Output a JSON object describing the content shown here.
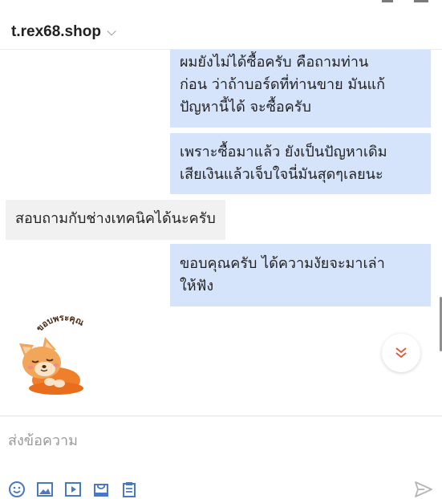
{
  "header": {
    "shop_name": "t.rex68.shop"
  },
  "messages": [
    {
      "side": "me",
      "text": "ผมยังไม่ได้ซื้อครับ คือถามท่าน\nก่อน ว่าถ้าบอร์ดที่ท่านขาย มันแก้\nปัญหานี้ได้ จะซื้อครับ"
    },
    {
      "side": "me",
      "text": "เพราะซื้อมาแล้ว ยังเป็นปัญหาเดิม\nเสียเงินแล้วเจ็บใจนี่มันสุดๆเลยนะ"
    },
    {
      "side": "them",
      "text": "สอบถามกับช่างเทคนิคได้นะครับ"
    },
    {
      "side": "me",
      "text": "ขอบคุณครับ ได้ความงัยจะมาเล่า\nให้ฟัง"
    }
  ],
  "sticker": {
    "text": "ขอบพระคุณ",
    "icon": "fox-thank-you-sticker"
  },
  "composer": {
    "placeholder": "ส่งข้อความ"
  },
  "toolbar": {
    "icons": [
      "emoji-icon",
      "image-icon",
      "video-icon",
      "product-icon",
      "order-icon"
    ],
    "send_icon": "send-icon"
  },
  "colors": {
    "my_bubble": "#d6e4fb",
    "their_bubble": "#f1f1f1",
    "icon_blue": "#4a78c2",
    "scroll_arrow": "#e0553a"
  }
}
